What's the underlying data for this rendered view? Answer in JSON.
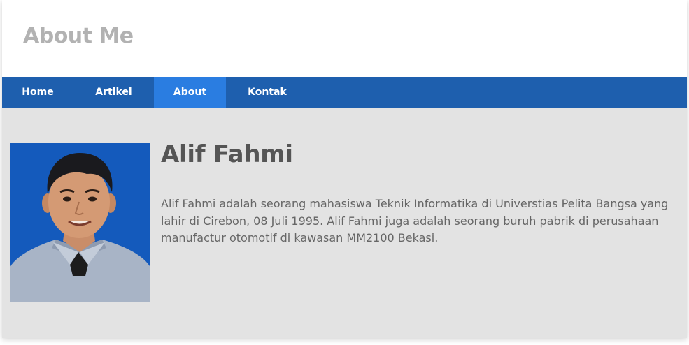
{
  "header": {
    "title": "About Me"
  },
  "nav": {
    "items": [
      {
        "label": "Home",
        "active": false
      },
      {
        "label": "Artikel",
        "active": false
      },
      {
        "label": "About",
        "active": true
      },
      {
        "label": "Kontak",
        "active": false
      }
    ]
  },
  "profile": {
    "name": "Alif Fahmi",
    "bio": "Alif Fahmi adalah seorang mahasiswa Teknik Informatika di Universtias Pelita Bangsa yang lahir di Cirebon, 08 Juli 1995. Alif Fahmi juga adalah seorang buruh pabrik di perusahaan manufactur otomotif di kawasan MM2100 Bekasi."
  },
  "colors": {
    "nav_bg": "#1e5fae",
    "nav_active": "#2a7de1",
    "content_bg": "#e3e3e3",
    "title_text": "#b2b2b2",
    "photo_bg": "#1860c4"
  }
}
